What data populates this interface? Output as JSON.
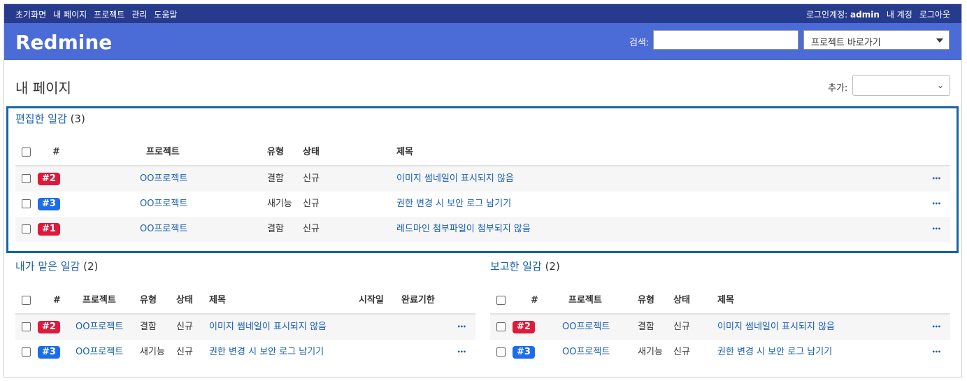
{
  "topnav": {
    "items": [
      "초기화면",
      "내 페이지",
      "프로젝트",
      "관리",
      "도움말"
    ],
    "logged_in_label": "로그인계정:",
    "user": "admin",
    "my_account": "내 계정",
    "logout": "로그아웃"
  },
  "header": {
    "logo": "Redmine",
    "search_label": "검색:",
    "search_value": "",
    "jump_label": "프로젝트 바로가기"
  },
  "page": {
    "title": "내 페이지",
    "add_label": "추가:",
    "add_value": ""
  },
  "colors": {
    "bug": "#e0183a",
    "feature": "#1c6ee8",
    "topbar": "#273b8e",
    "header": "#4b6bd6",
    "highlight": "#1565a8"
  },
  "edited": {
    "title": "편집한 일감",
    "count": "(3)",
    "headers": {
      "num": "#",
      "project": "프로젝트",
      "tracker": "유형",
      "status": "상태",
      "subject": "제목"
    },
    "rows": [
      {
        "id": "#2",
        "project": "OO프로젝트",
        "tracker": "결함",
        "status": "신규",
        "subject": "이미지 썸네일이 표시되지 않음",
        "kind": "bug"
      },
      {
        "id": "#3",
        "project": "OO프로젝트",
        "tracker": "새기능",
        "status": "신규",
        "subject": "권한 변경 시 보안 로그 남기기",
        "kind": "feature"
      },
      {
        "id": "#1",
        "project": "OO프로젝트",
        "tracker": "결함",
        "status": "신규",
        "subject": "레드마인 첨부파일이 첨부되지 않음",
        "kind": "bug"
      }
    ]
  },
  "assigned": {
    "title": "내가 맡은 일감",
    "count": "(2)",
    "headers": {
      "num": "#",
      "project": "프로젝트",
      "tracker": "유형",
      "status": "상태",
      "subject": "제목",
      "start": "시작일",
      "due": "완료기한"
    },
    "rows": [
      {
        "id": "#2",
        "project": "OO프로젝트",
        "tracker": "결함",
        "status": "신규",
        "subject": "이미지 썸네일이 표시되지 않음",
        "kind": "bug"
      },
      {
        "id": "#3",
        "project": "OO프로젝트",
        "tracker": "새기능",
        "status": "신규",
        "subject": "권한 변경 시 보안 로그 남기기",
        "kind": "feature"
      }
    ]
  },
  "reported": {
    "title": "보고한 일감",
    "count": "(2)",
    "headers": {
      "num": "#",
      "project": "프로젝트",
      "tracker": "유형",
      "status": "상태",
      "subject": "제목"
    },
    "rows": [
      {
        "id": "#2",
        "project": "OO프로젝트",
        "tracker": "결함",
        "status": "신규",
        "subject": "이미지 썸네일이 표시되지 않음",
        "kind": "bug"
      },
      {
        "id": "#3",
        "project": "OO프로젝트",
        "tracker": "새기능",
        "status": "신규",
        "subject": "권한 변경 시 보안 로그 남기기",
        "kind": "feature"
      }
    ]
  }
}
